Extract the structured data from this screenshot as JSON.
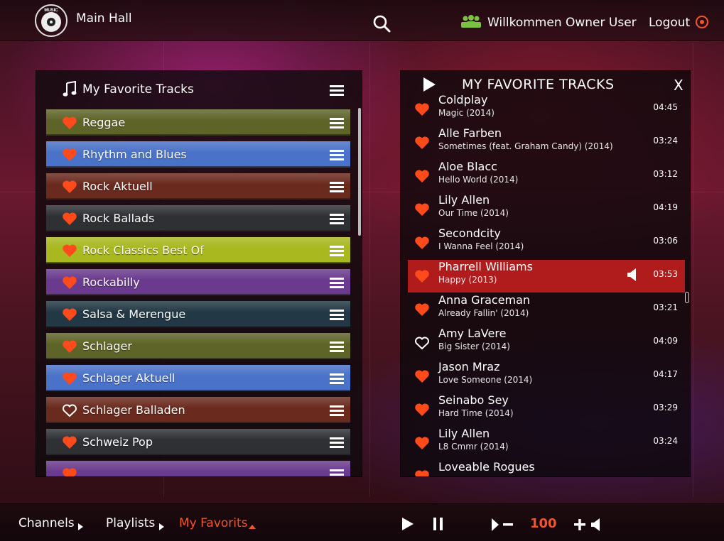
{
  "colors": {
    "accent": "#f2542d",
    "playing_row": "#b01c1c",
    "heart": "#ff4a1c",
    "user_icon": "#7bc242"
  },
  "header": {
    "logo_text": "MUSIC",
    "room_title": "Main Hall",
    "welcome": "Willkommen Owner User",
    "logout": "Logout"
  },
  "left_panel": {
    "title": "My Favorite Tracks",
    "channels": [
      {
        "label": "Reggae",
        "color": "#5e6428",
        "favorite": true
      },
      {
        "label": "Rhythm and Blues",
        "color": "#4a72c8",
        "favorite": true
      },
      {
        "label": "Rock Aktuell",
        "color": "#6a2a1e",
        "favorite": true
      },
      {
        "label": "Rock Ballads",
        "color": "#2e3034",
        "favorite": true
      },
      {
        "label": "Rock Classics Best Of",
        "color": "#a8b81e",
        "favorite": true
      },
      {
        "label": "Rockabilly",
        "color": "#6a3a8e",
        "favorite": true
      },
      {
        "label": "Salsa & Merengue",
        "color": "#223844",
        "favorite": true
      },
      {
        "label": "Schlager",
        "color": "#5e6428",
        "favorite": true
      },
      {
        "label": "Schlager Aktuell",
        "color": "#4a72c8",
        "favorite": true
      },
      {
        "label": "Schlager Balladen",
        "color": "#6a2a1e",
        "favorite": false
      },
      {
        "label": "Schweiz Pop",
        "color": "#2e3034",
        "favorite": true
      },
      {
        "label": "",
        "color": "#6a3a8e",
        "favorite": true
      }
    ]
  },
  "right_panel": {
    "title": "MY FAVORITE TRACKS",
    "close": "X",
    "tracks": [
      {
        "artist": "Coldplay",
        "song": "Magic (2014)",
        "duration": "04:45",
        "favorite": true,
        "playing": false
      },
      {
        "artist": "Alle Farben",
        "song": "Sometimes (feat. Graham Candy) (2014)",
        "duration": "03:24",
        "favorite": true,
        "playing": false
      },
      {
        "artist": "Aloe Blacc",
        "song": "Hello World (2014)",
        "duration": "03:12",
        "favorite": true,
        "playing": false
      },
      {
        "artist": "Lily Allen",
        "song": "Our Time (2014)",
        "duration": "04:19",
        "favorite": true,
        "playing": false
      },
      {
        "artist": "Secondcity",
        "song": "I Wanna Feel (2014)",
        "duration": "03:06",
        "favorite": true,
        "playing": false
      },
      {
        "artist": "Pharrell Williams",
        "song": "Happy (2013)",
        "duration": "03:53",
        "favorite": true,
        "playing": true
      },
      {
        "artist": "Anna Graceman",
        "song": "Already Fallin' (2014)",
        "duration": "03:21",
        "favorite": true,
        "playing": false
      },
      {
        "artist": "Amy LaVere",
        "song": "Big Sister (2014)",
        "duration": "04:09",
        "favorite": false,
        "playing": false
      },
      {
        "artist": "Jason Mraz",
        "song": "Love Someone (2014)",
        "duration": "04:17",
        "favorite": true,
        "playing": false
      },
      {
        "artist": "Seinabo Sey",
        "song": "Hard Time (2014)",
        "duration": "03:29",
        "favorite": true,
        "playing": false
      },
      {
        "artist": "Lily Allen",
        "song": "L8 Cmmr (2014)",
        "duration": "03:24",
        "favorite": true,
        "playing": false
      },
      {
        "artist": "Loveable Rogues",
        "song": "",
        "duration": "",
        "favorite": true,
        "playing": false
      }
    ]
  },
  "footer": {
    "breadcrumbs": [
      {
        "label": "Channels",
        "active": false
      },
      {
        "label": "Playlists",
        "active": false
      },
      {
        "label": "My Favorits",
        "active": true
      }
    ],
    "volume": "100"
  }
}
